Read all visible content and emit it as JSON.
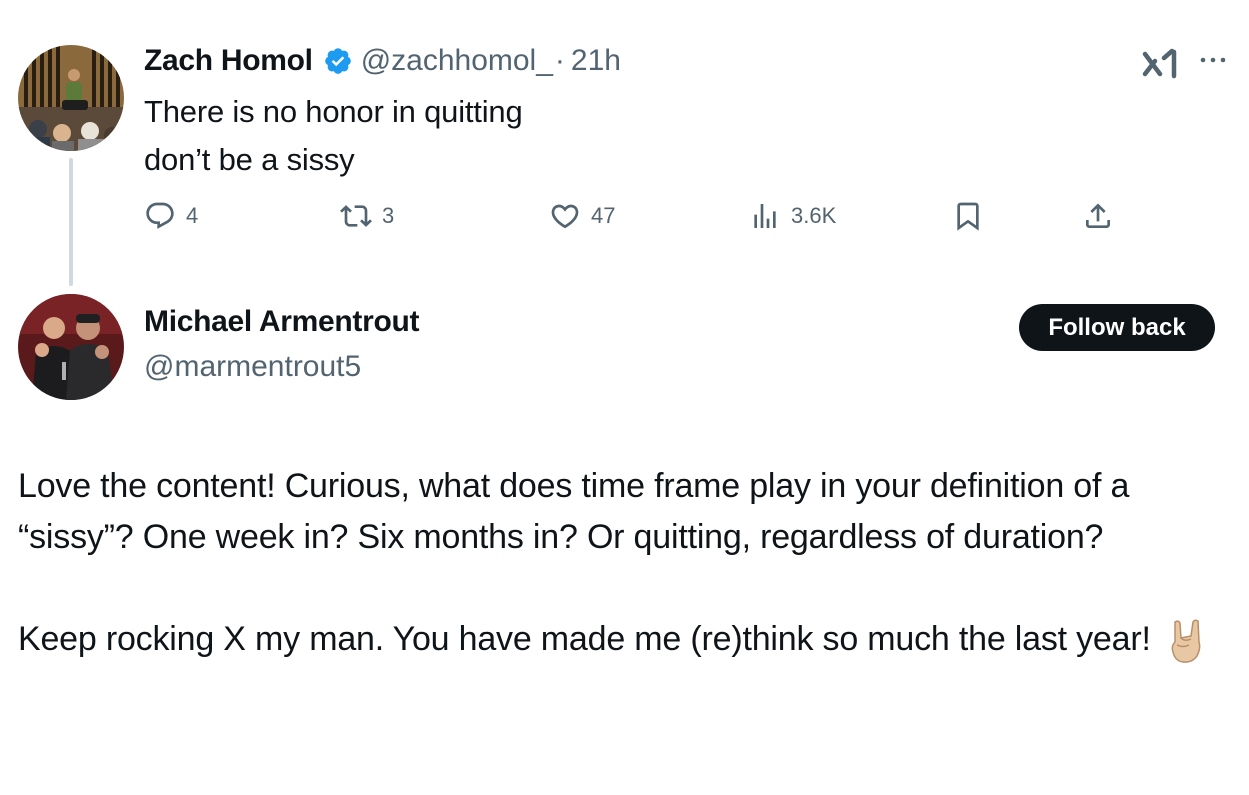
{
  "original_tweet": {
    "author_name": "Zach Homol",
    "verified": true,
    "handle": "@zachhomol_",
    "separator": "·",
    "time": "21h",
    "text_lines": [
      "There is no honor in quitting",
      "don’t be a sissy"
    ],
    "metrics": {
      "replies": "4",
      "reposts": "3",
      "likes": "47",
      "views": "3.6K"
    },
    "icons": [
      "grok-xai-icon",
      "more-icon",
      "reply-icon",
      "repost-icon",
      "like-icon",
      "views-icon",
      "bookmark-icon",
      "share-icon"
    ]
  },
  "reply": {
    "author_name": "Michael Armentrout",
    "handle": "@marmentrout5",
    "follow_button_label": "Follow back",
    "paragraph_1": "Love the content!  Curious, what does time frame play in your definition of a “sissy”?  One week in?  Six months in?  Or quitting, regardless of duration?",
    "paragraph_2": "Keep rocking X my man. You have made me (re)think so much the last year!",
    "emoji": "rock-on-hand"
  },
  "colors": {
    "text_primary": "#0f1419",
    "text_secondary": "#536471",
    "verified_blue": "#1d9bf0",
    "thread_line": "#cfd9de",
    "button_bg": "#0f1419"
  }
}
